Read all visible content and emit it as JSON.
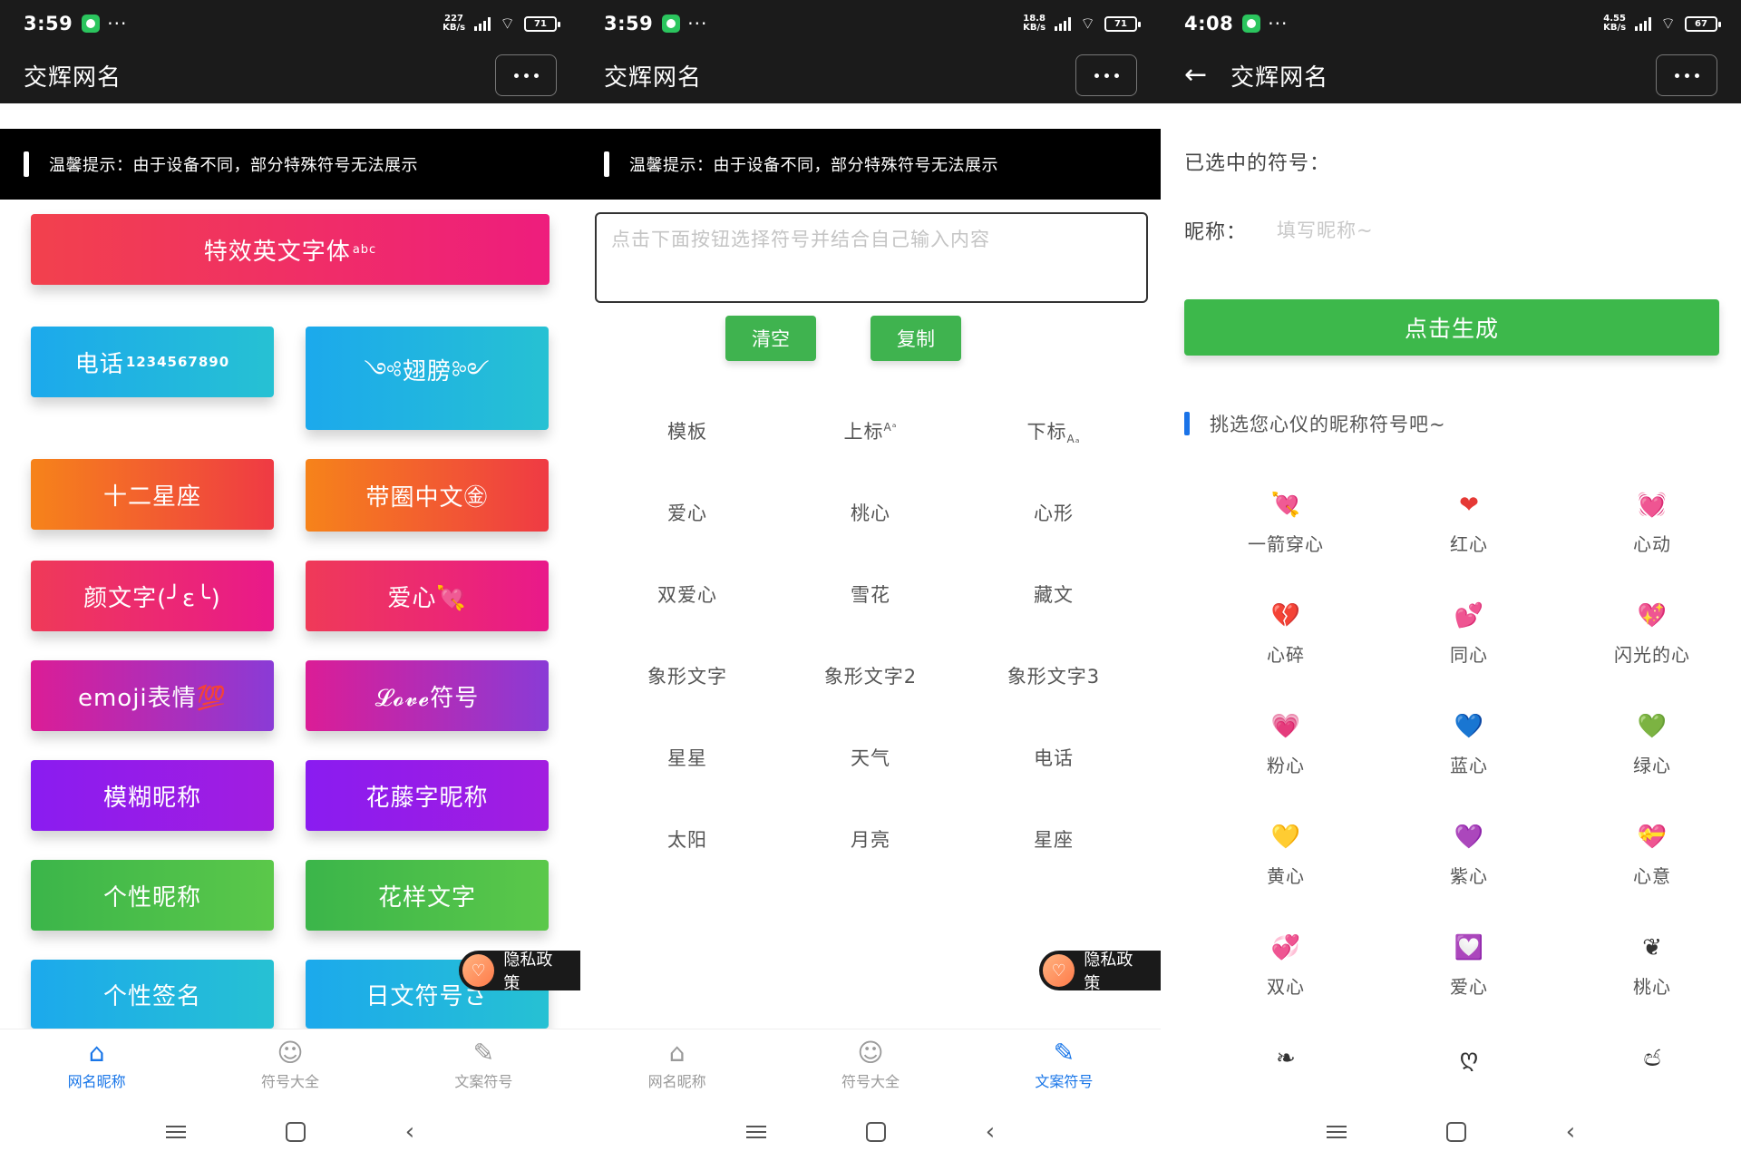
{
  "status_bars": [
    {
      "time": "3:59",
      "speed_top": "227",
      "speed_bottom": "KB/s",
      "battery": "71"
    },
    {
      "time": "3:59",
      "speed_top": "18.8",
      "speed_bottom": "KB/s",
      "battery": "71"
    },
    {
      "time": "4:08",
      "speed_top": "4.55",
      "speed_bottom": "KB/s",
      "battery": "67"
    }
  ],
  "app_title": "交辉网名",
  "tip": "温馨提示：由于设备不同，部分特殊符号无法展示",
  "panel1": {
    "buttons": [
      {
        "label": "特效英文字体",
        "sup": "abc"
      },
      {
        "label": "电话",
        "extra": "1234567890"
      },
      {
        "label": "༺翅膀༻"
      },
      {
        "label": "十二星座"
      },
      {
        "label": "带圈中文㊎"
      },
      {
        "label": "颜文字(╯ε╰)"
      },
      {
        "label": "爱心💘"
      },
      {
        "label": "emoji表情💯"
      },
      {
        "label": "𝓛𝓸𝓿𝓮符号"
      },
      {
        "label": "模糊昵称"
      },
      {
        "label": "花藤字昵称"
      },
      {
        "label": "个性昵称"
      },
      {
        "label": "花样文字"
      },
      {
        "label": "个性签名"
      },
      {
        "label": "日文符号さ"
      }
    ]
  },
  "privacy_label": "隐私政策",
  "tabs": [
    {
      "label": "网名昵称",
      "icon": "home-icon"
    },
    {
      "label": "符号大全",
      "icon": "smile-icon"
    },
    {
      "label": "文案符号",
      "icon": "pencil-icon"
    }
  ],
  "panel2": {
    "input_placeholder": "点击下面按钮选择符号并结合自己输入内容",
    "clear_label": "清空",
    "copy_label": "复制",
    "categories": [
      {
        "label": "模板"
      },
      {
        "label": "上标",
        "sup": "Aᵃ"
      },
      {
        "label": "下标",
        "sub": "Aₐ"
      },
      {
        "label": "爱心"
      },
      {
        "label": "桃心"
      },
      {
        "label": "心形"
      },
      {
        "label": "双爱心"
      },
      {
        "label": "雪花"
      },
      {
        "label": "藏文"
      },
      {
        "label": "象形文字"
      },
      {
        "label": "象形文字2"
      },
      {
        "label": "象形文字3"
      },
      {
        "label": "星星"
      },
      {
        "label": "天气"
      },
      {
        "label": "电话"
      },
      {
        "label": "太阳"
      },
      {
        "label": "月亮"
      },
      {
        "label": "星座"
      }
    ]
  },
  "panel3": {
    "selected_label": "已选中的符号：",
    "nickname_label": "昵称：",
    "nickname_placeholder": "填写昵称~",
    "generate_label": "点击生成",
    "section_title": "挑选您心仪的昵称符号吧~",
    "symbols": [
      {
        "sym": "💘",
        "label": "一箭穿心",
        "color": "#e8478b"
      },
      {
        "sym": "❤",
        "label": "红心",
        "color": "#e53935"
      },
      {
        "sym": "💓",
        "label": "心动",
        "color": "#ec5c9a"
      },
      {
        "sym": "💔",
        "label": "心碎",
        "color": "#e53935"
      },
      {
        "sym": "💕",
        "label": "同心",
        "color": "#ec407a"
      },
      {
        "sym": "💖",
        "label": "闪光的心",
        "color": "#ec407a"
      },
      {
        "sym": "💗",
        "label": "粉心",
        "color": "#ec407a"
      },
      {
        "sym": "💙",
        "label": "蓝心",
        "color": "#1e88e5"
      },
      {
        "sym": "💚",
        "label": "绿心",
        "color": "#43a047"
      },
      {
        "sym": "💛",
        "label": "黄心",
        "color": "#fbc02d"
      },
      {
        "sym": "💜",
        "label": "紫心",
        "color": "#8e24aa"
      },
      {
        "sym": "💝",
        "label": "心意",
        "color": "#e53935"
      },
      {
        "sym": "💞",
        "label": "双心",
        "color": "#ec407a"
      },
      {
        "sym": "💟",
        "label": "爱心",
        "color": "#ab47bc"
      },
      {
        "sym": "❦",
        "label": "桃心",
        "color": "#333333"
      },
      {
        "sym": "❧",
        "label": "",
        "color": "#333333"
      },
      {
        "sym": "ღ",
        "label": "",
        "color": "#333333"
      },
      {
        "sym": "ඦ",
        "label": "",
        "color": "#333333"
      }
    ]
  },
  "colors": {
    "active_tab": "#1976e8",
    "green": "#3db84b",
    "topbar": "#1b1b1b"
  }
}
